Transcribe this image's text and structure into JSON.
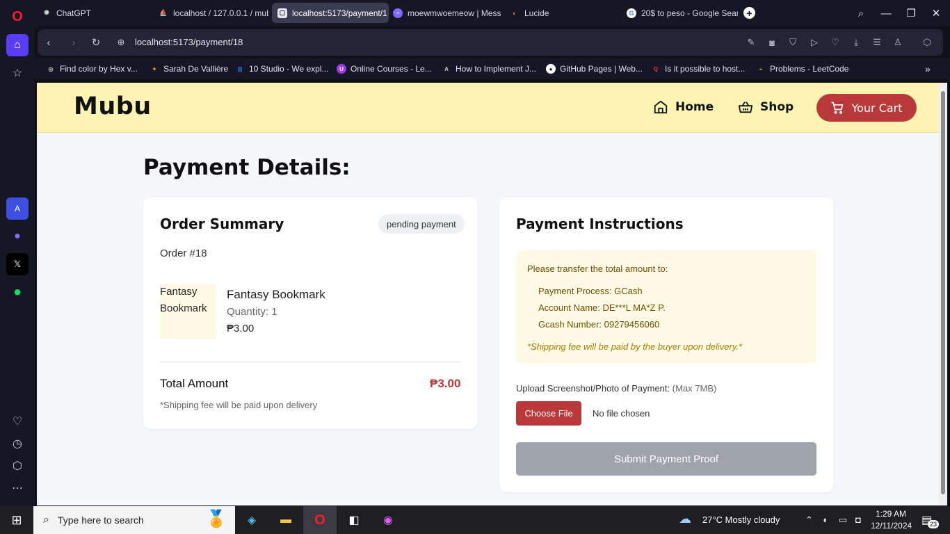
{
  "browser": {
    "tabs": [
      {
        "label": "ChatGPT",
        "favicon": "chatgpt-icon"
      },
      {
        "label": "localhost / 127.0.0.1 / mub",
        "favicon": "phpmyadmin-icon"
      },
      {
        "label": "localhost:5173/payment/1",
        "favicon": "page-icon",
        "active": true
      },
      {
        "label": "moewmwoemeow | Mess",
        "favicon": "messenger-icon"
      },
      {
        "label": "Lucide",
        "favicon": "lucide-icon"
      },
      {
        "label": "20$ to peso - Google Searc",
        "favicon": "google-icon"
      }
    ],
    "new_tab": "+",
    "url": "localhost:5173/payment/18",
    "bookmarks": [
      {
        "label": "Find color by Hex v..."
      },
      {
        "label": "Sarah De Vallière"
      },
      {
        "label": "10 Studio - We expl..."
      },
      {
        "label": "Online Courses - Le..."
      },
      {
        "label": "How to Implement J..."
      },
      {
        "label": "GitHub Pages | Web..."
      },
      {
        "label": "Is it possible to host..."
      },
      {
        "label": "Problems - LeetCode"
      }
    ]
  },
  "site": {
    "logo": "Mubu",
    "nav": {
      "home": "Home",
      "shop": "Shop",
      "cart": "Your Cart"
    }
  },
  "page": {
    "title": "Payment Details:",
    "order_summary": {
      "title": "Order Summary",
      "status": "pending payment",
      "order_number": "Order #18",
      "item": {
        "image_alt": "Fantasy Bookmark",
        "name": "Fantasy Bookmark",
        "quantity": "Quantity: 1",
        "price": "₱3.00"
      },
      "total_label": "Total Amount",
      "total_value": "₱3.00",
      "shipping_note": "*Shipping fee will be paid upon delivery"
    },
    "payment_instructions": {
      "title": "Payment Instructions",
      "intro": "Please transfer the total amount to:",
      "process": "Payment Process: GCash",
      "account_name": "Account Name: DE***L MA*Z P.",
      "gcash_number": "Gcash Number: 09279456060",
      "shipping_note": "*Shipping fee will be paid by the buyer upon delivery.*",
      "upload_label": "Upload Screenshot/Photo of Payment:",
      "upload_limit": "(Max 7MB)",
      "choose_file": "Choose File",
      "no_file": "No file chosen",
      "submit": "Submit Payment Proof"
    }
  },
  "taskbar": {
    "search_placeholder": "Type here to search",
    "weather": "27°C  Mostly cloudy",
    "time": "1:29 AM",
    "date": "12/11/2024",
    "notifications": "23"
  },
  "colors": {
    "header_bg": "#fdf4b3",
    "accent_red": "#b9383a",
    "submit_disabled": "#9ea3ad",
    "instructions_bg": "#fefae5",
    "page_bg": "#f5f7fa"
  }
}
